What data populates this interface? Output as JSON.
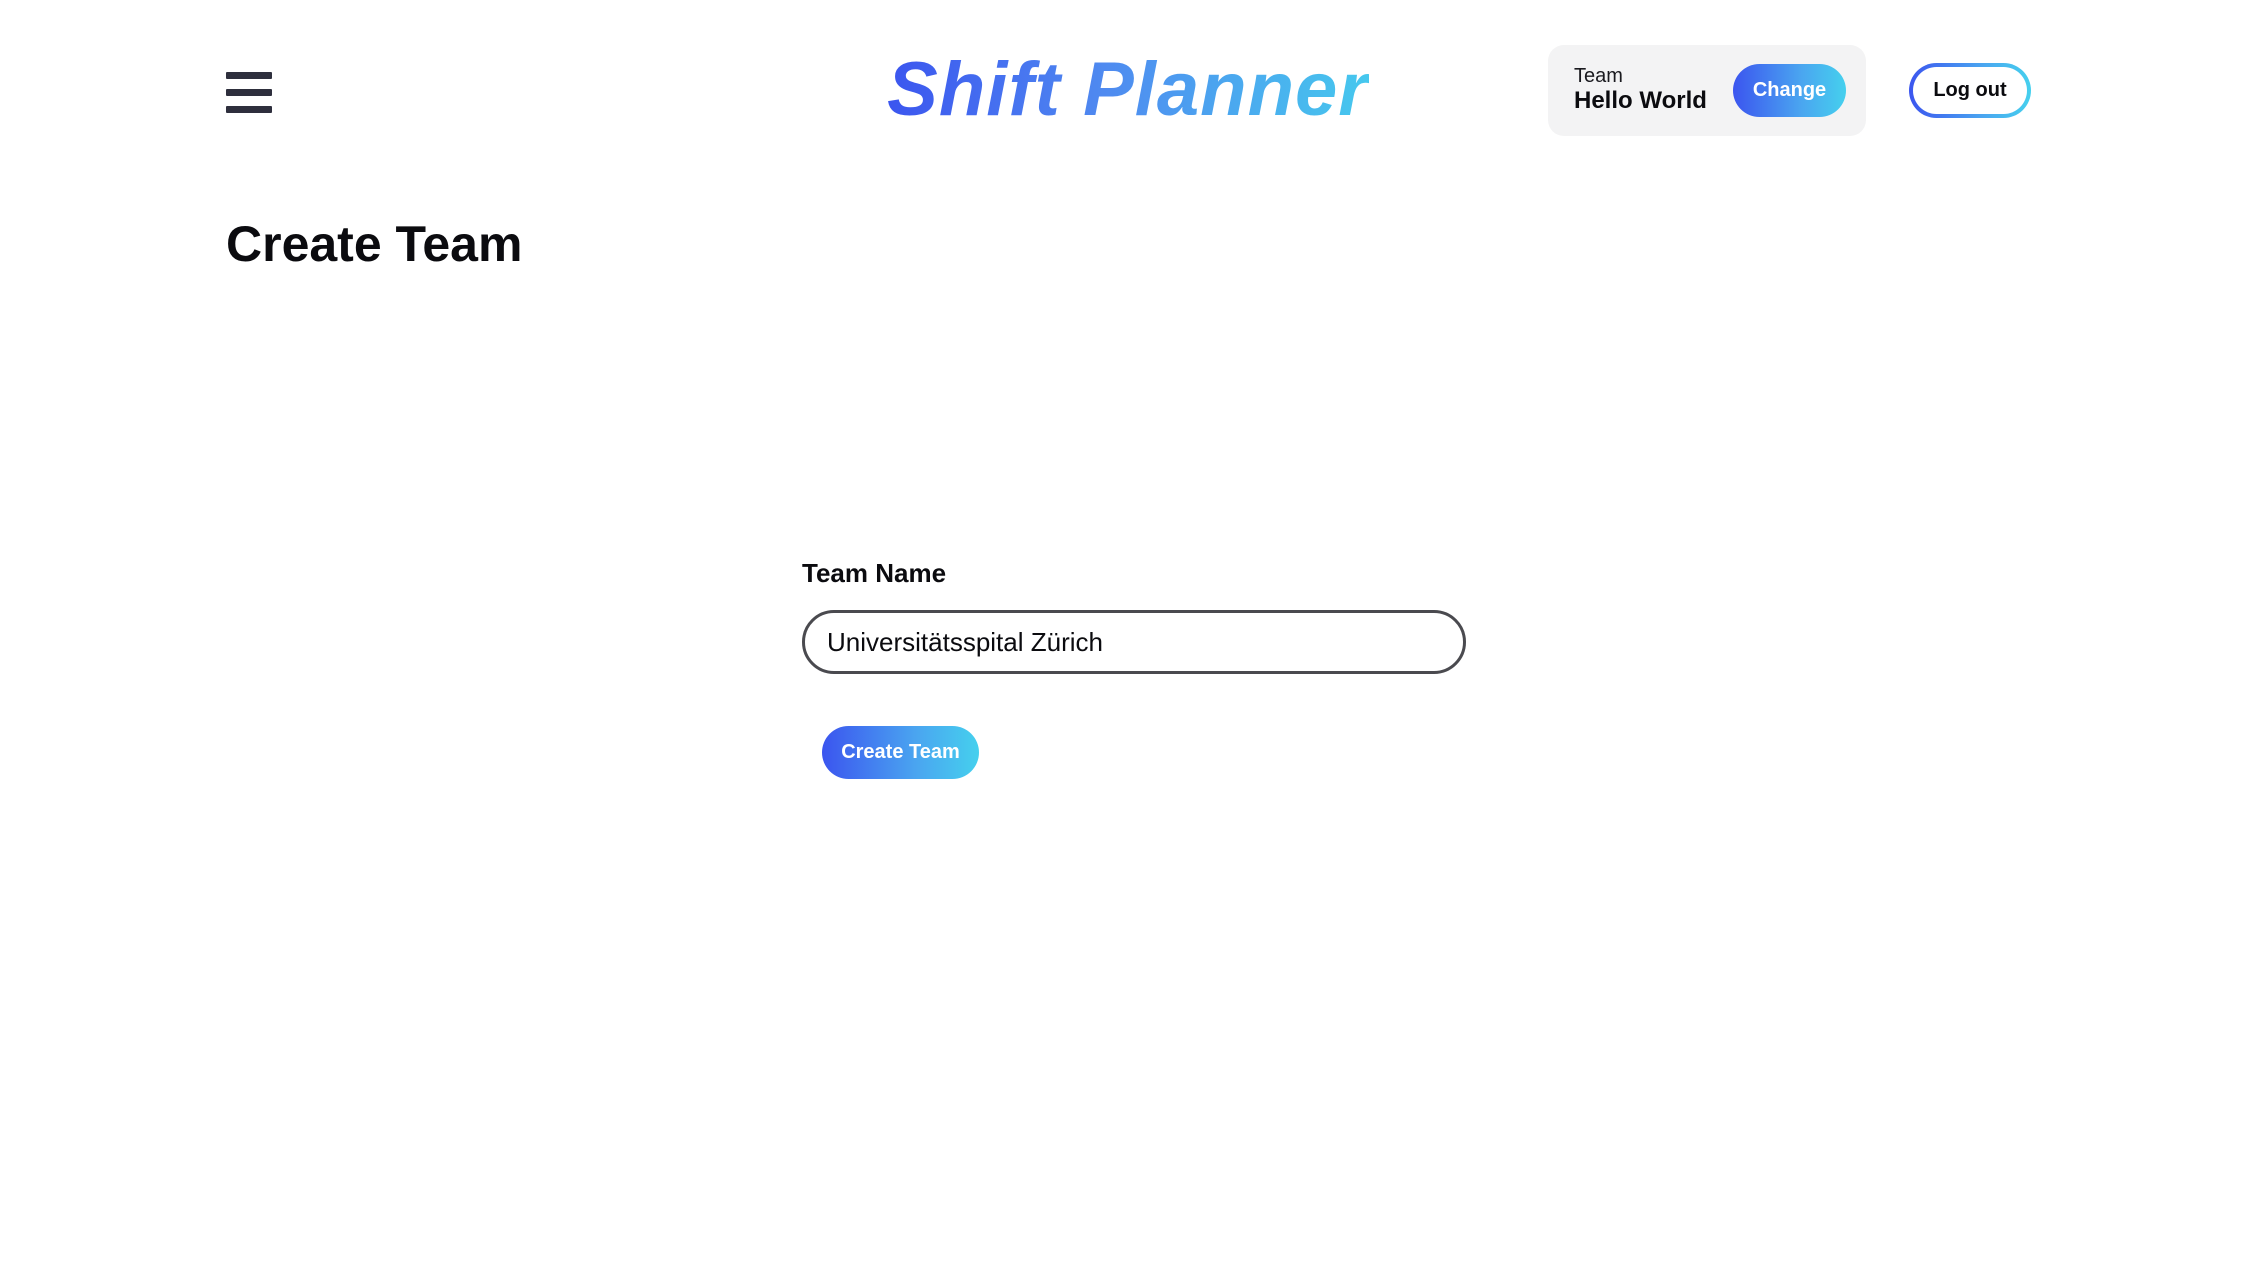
{
  "header": {
    "brand": "Shift Planner",
    "menu_icon": "hamburger-menu-icon",
    "team_card": {
      "label": "Team",
      "name": "Hello World",
      "change_label": "Change"
    },
    "logout_label": "Log out"
  },
  "main": {
    "title": "Create Team",
    "form": {
      "team_name_label": "Team Name",
      "team_name_value": "Universitätsspital Zürich",
      "submit_label": "Create Team"
    }
  },
  "colors": {
    "gradient_start": "#3b55ef",
    "gradient_end": "#45d0ee",
    "text": "#0b0b0f",
    "card_bg": "#f3f3f4"
  }
}
